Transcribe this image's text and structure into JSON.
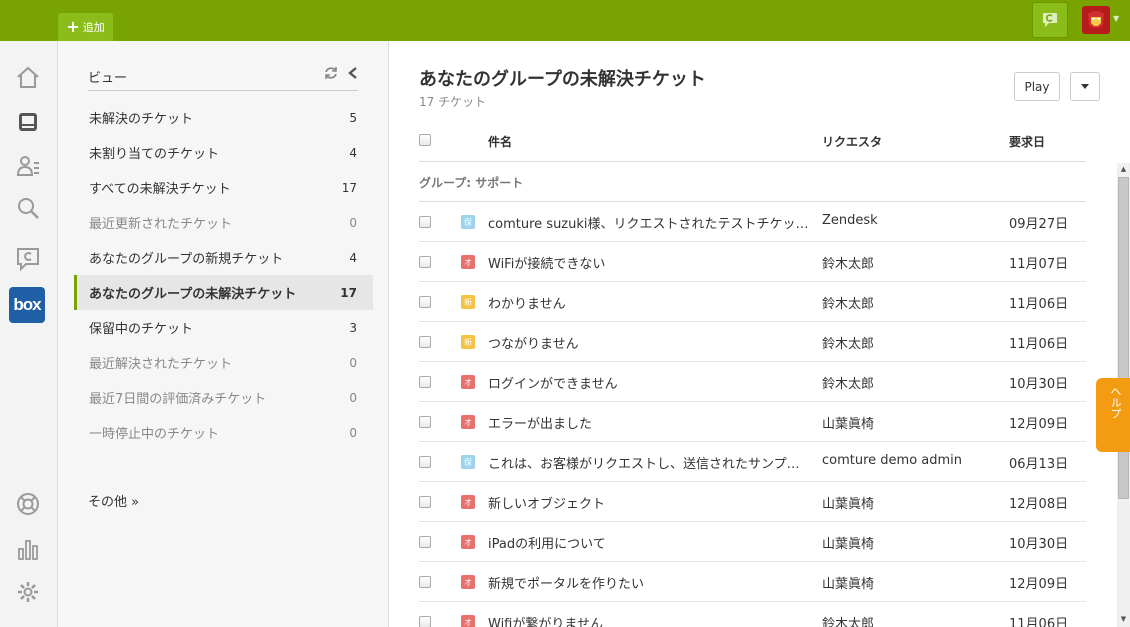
{
  "topbar": {
    "add_label": "追加",
    "add_icon": "plus-icon",
    "chat_icon": "chat-icon",
    "avatar_icon": "ironman-avatar",
    "accent": "#78a300"
  },
  "rail": {
    "icons": [
      "home-icon",
      "views-icon",
      "users-icon",
      "search-icon",
      "chat-icon",
      "box-app-icon",
      "help-lifebuoy-icon",
      "reports-icon",
      "settings-icon"
    ],
    "box_label": "box"
  },
  "views": {
    "title": "ビュー",
    "items": [
      {
        "label": "未解決のチケット",
        "count": "5"
      },
      {
        "label": "未割り当てのチケット",
        "count": "4"
      },
      {
        "label": "すべての未解決チケット",
        "count": "17"
      },
      {
        "label": "最近更新されたチケット",
        "count": "0"
      },
      {
        "label": "あなたのグループの新規チケット",
        "count": "4"
      },
      {
        "label": "あなたのグループの未解決チケット",
        "count": "17"
      },
      {
        "label": "保留中のチケット",
        "count": "3"
      },
      {
        "label": "最近解決されたチケット",
        "count": "0"
      },
      {
        "label": "最近7日間の評価済みチケット",
        "count": "0"
      },
      {
        "label": "一時停止中のチケット",
        "count": "0"
      }
    ],
    "more": "その他 »"
  },
  "main": {
    "title": "あなたのグループの未解決チケット",
    "subtitle": "17 チケット",
    "play_label": "Play",
    "columns": {
      "subject": "件名",
      "requester": "リクエスタ",
      "date": "要求日"
    },
    "group_label": "グループ: サポート",
    "rows": [
      {
        "badge": "保",
        "color": "#9fd3ec",
        "subject": "comture suzuki様、リクエストされたテストチケットをお送りします",
        "requester": "Zendesk",
        "date": "09月27日"
      },
      {
        "badge": "オ",
        "color": "#e8716c",
        "subject": "WiFiが接続できない",
        "requester": "鈴木太郎",
        "date": "11月07日"
      },
      {
        "badge": "新",
        "color": "#f5c244",
        "subject": "わかりません",
        "requester": "鈴木太郎",
        "date": "11月06日"
      },
      {
        "badge": "新",
        "color": "#f5c244",
        "subject": "つながりません",
        "requester": "鈴木太郎",
        "date": "11月06日"
      },
      {
        "badge": "オ",
        "color": "#e8716c",
        "subject": "ログインができません",
        "requester": "鈴木太郎",
        "date": "10月30日"
      },
      {
        "badge": "オ",
        "color": "#e8716c",
        "subject": "エラーが出ました",
        "requester": "山葉眞椅",
        "date": "12月09日"
      },
      {
        "badge": "保",
        "color": "#9fd3ec",
        "subject": "これは、お客様がリクエストし、送信されたサンプルチケットです",
        "requester": "comture demo admin",
        "date": "06月13日"
      },
      {
        "badge": "オ",
        "color": "#e8716c",
        "subject": "新しいオブジェクト",
        "requester": "山葉眞椅",
        "date": "12月08日"
      },
      {
        "badge": "オ",
        "color": "#e8716c",
        "subject": "iPadの利用について",
        "requester": "山葉眞椅",
        "date": "10月30日"
      },
      {
        "badge": "オ",
        "color": "#e8716c",
        "subject": "新規でポータルを作りたい",
        "requester": "山葉眞椅",
        "date": "12月09日"
      },
      {
        "badge": "オ",
        "color": "#e8716c",
        "subject": "Wifiが繋がりません",
        "requester": "鈴木太郎",
        "date": "11月06日"
      }
    ]
  },
  "help": {
    "label": "ヘルプ",
    "color": "#f39c12"
  }
}
